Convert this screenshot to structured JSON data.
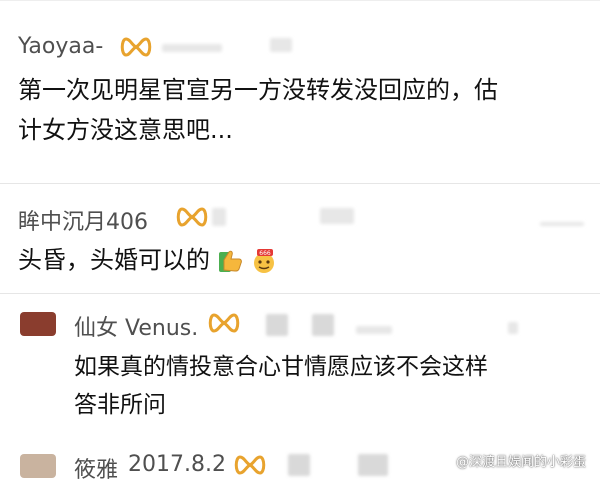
{
  "comments": [
    {
      "username": "Yaoyaa-",
      "text": "第一次见明星官宣另一方没转发没回应的，估计女方没这意思吧...",
      "line1": "第一次见明星官宣另一方没转发没回应的，估",
      "line2": "计女方没这意思吧...",
      "badge_icon": "vip-badge-icon"
    },
    {
      "username": "眸中沉月406",
      "text": "头昏，头婚可以的",
      "badge_icon": "vip-badge-icon",
      "emojis": [
        "thumbs-up-emoji-icon",
        "666-emoji-icon"
      ]
    }
  ],
  "replies": [
    {
      "username": "仙女 Venus.",
      "line1": "如果真的情投意合心甘情愿应该不会这样",
      "line2": "答非所问",
      "avatar_color": "#8a3d2e",
      "badge_icon": "vip-badge-icon"
    },
    {
      "username": "筱雅",
      "date": "2017.8.2",
      "avatar_color": "#c9b39f",
      "badge_icon": "vip-badge-icon"
    }
  ],
  "watermark": "@深渡且娱闻的小彩蛋",
  "colors": {
    "badge": "#e8a32e",
    "username": "#4f4f4f",
    "text": "#111111",
    "divider": "#e6e6e6"
  }
}
